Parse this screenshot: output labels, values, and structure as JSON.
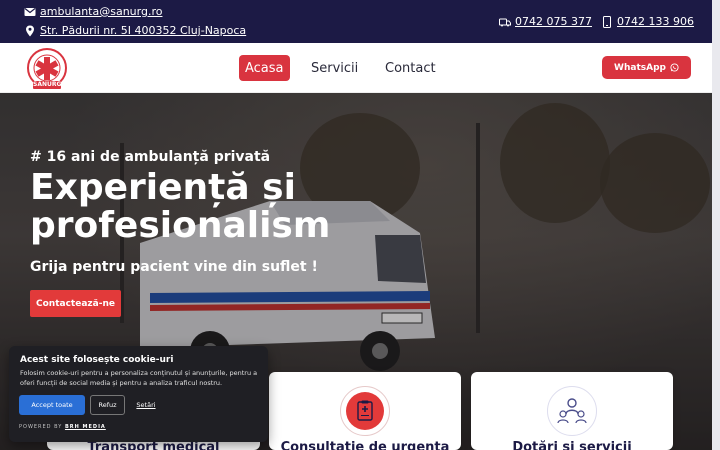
{
  "topbar": {
    "email": "ambulanta@sanurg.ro",
    "address": "Str. Pădurii nr. 5I 400352 Cluj-Napoca",
    "phone1": "0742 075 377",
    "phone2": "0742 133 906"
  },
  "logo": {
    "text": "SANURG",
    "ring_text": "SERVICIUL DE AMBULANȚĂ"
  },
  "nav": {
    "items": [
      {
        "label": "Acasa",
        "active": true
      },
      {
        "label": "Servicii",
        "active": false
      },
      {
        "label": "Contact",
        "active": false
      }
    ],
    "whatsapp_label": "WhatsApp"
  },
  "hero": {
    "subtitle": "# 16 ani de ambulanță privată",
    "title": "Experiență și profesionalism",
    "tagline": "Grija pentru pacient vine din suflet !",
    "cta_label": "Contactează-ne"
  },
  "cards": [
    {
      "title": "Transport medical",
      "icon": "ambulance-icon"
    },
    {
      "title": "Consultație de urgența",
      "icon": "medical-clipboard-icon"
    },
    {
      "title": "Dotări și servicii",
      "icon": "medical-team-icon"
    }
  ],
  "cookie": {
    "title": "Acest site folosește cookie-uri",
    "description": "Folosim cookie-uri pentru a personaliza conținutul și anunțurile, pentru a oferi funcții de social media și pentru a analiza traficul nostru.",
    "accept_label": "Accept toate",
    "refuse_label": "Refuz",
    "settings_label": "Setări",
    "powered_prefix": "POWERED BY",
    "powered_brand": "BRH MEDIA"
  },
  "colors": {
    "navy": "#1c1a45",
    "brand_red": "#d9343f",
    "cookie_bg": "#1f1f24",
    "accept_blue": "#2a6fd6"
  }
}
